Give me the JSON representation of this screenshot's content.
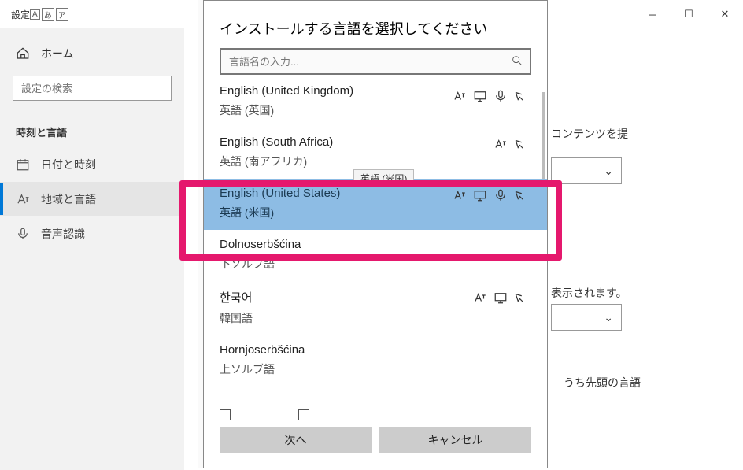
{
  "bg": {
    "title": "設定",
    "home": "ホーム",
    "search_placeholder": "設定の検索",
    "group": "時刻と言語",
    "items": [
      "日付と時刻",
      "地域と言語",
      "音声認識"
    ],
    "frag1": "コンテンツを提",
    "frag2": "表示されます。",
    "frag3": "うち先頭の言語"
  },
  "dialog": {
    "title": "インストールする言語を選択してください",
    "search_placeholder": "言語名の入力...",
    "tooltip": "英語 (米国)",
    "next": "次へ",
    "cancel": "キャンセル"
  },
  "languages": [
    {
      "native": "English (United Kingdom)",
      "local": "英語 (英国)",
      "caps": [
        "tts",
        "display",
        "speech",
        "hand"
      ]
    },
    {
      "native": "English (South Africa)",
      "local": "英語 (南アフリカ)",
      "caps": [
        "tts",
        "hand"
      ]
    },
    {
      "native": "English (United States)",
      "local": "英語 (米国)",
      "caps": [
        "tts",
        "display",
        "speech",
        "hand"
      ],
      "selected": true
    },
    {
      "native": "Dolnoserbšćina",
      "local": "下ソルブ語",
      "caps": []
    },
    {
      "native": "한국어",
      "local": "韓国語",
      "caps": [
        "tts",
        "display",
        "hand"
      ]
    },
    {
      "native": "Hornjoserbšćina",
      "local": "上ソルブ語",
      "caps": []
    }
  ]
}
